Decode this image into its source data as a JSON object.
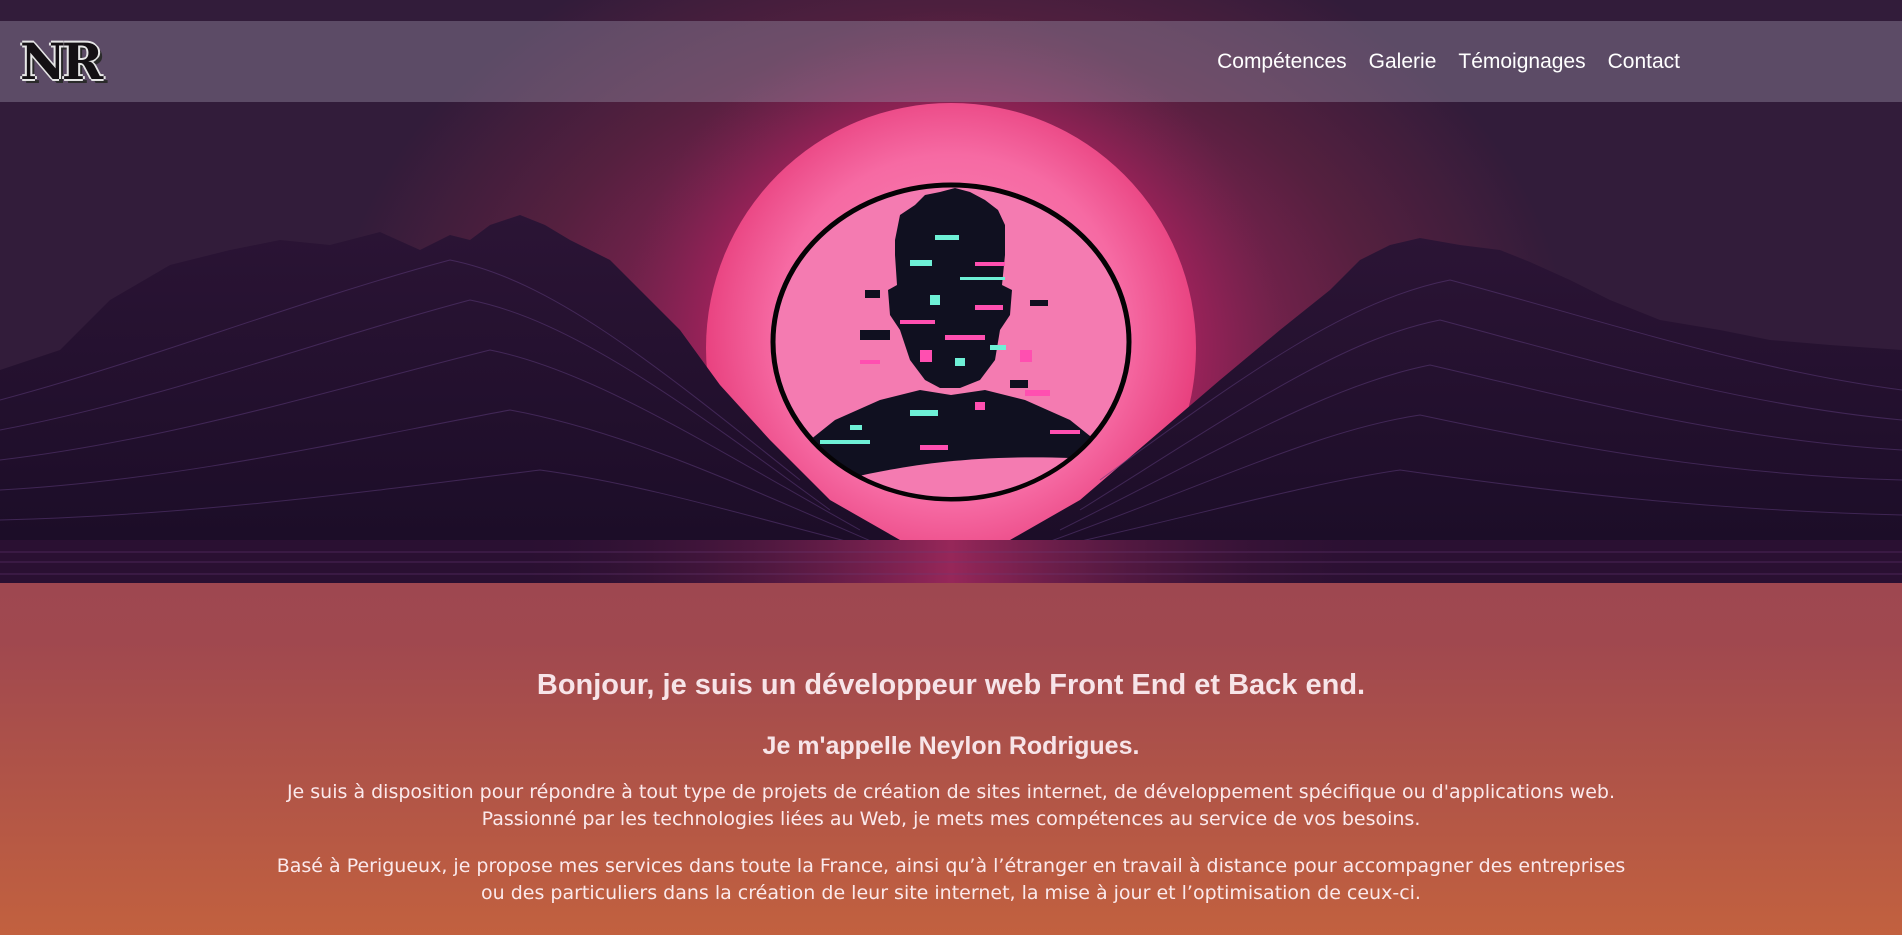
{
  "header": {
    "logo_text": "NR",
    "nav": [
      {
        "label": "Compétences"
      },
      {
        "label": "Galerie"
      },
      {
        "label": "Témoignages"
      },
      {
        "label": "Contact"
      }
    ]
  },
  "hero": {
    "portrait_icon": "glitch-avatar-icon",
    "colors": {
      "sun": "#f76aa4",
      "glow": "#e4246a",
      "mountains": "#22122e",
      "sky": "#3a1c3f"
    }
  },
  "intro": {
    "headline": "Bonjour, je suis un développeur web Front End et Back end.",
    "name_line": "Je m'appelle Neylon Rodrigues.",
    "paragraph1": "Je suis à disposition pour répondre à tout type de projets de création de sites internet, de développement spécifique ou d'applications web. Passionné par les technologies liées au Web, je mets mes compétences au service de vos besoins.",
    "paragraph2": "Basé à Perigueux, je propose mes services dans toute la France, ainsi qu’à l’étranger en travail à distance pour accompagner des entreprises ou des particuliers dans la création de leur site internet, la mise à jour et l’optimisation de ceux-ci."
  }
}
